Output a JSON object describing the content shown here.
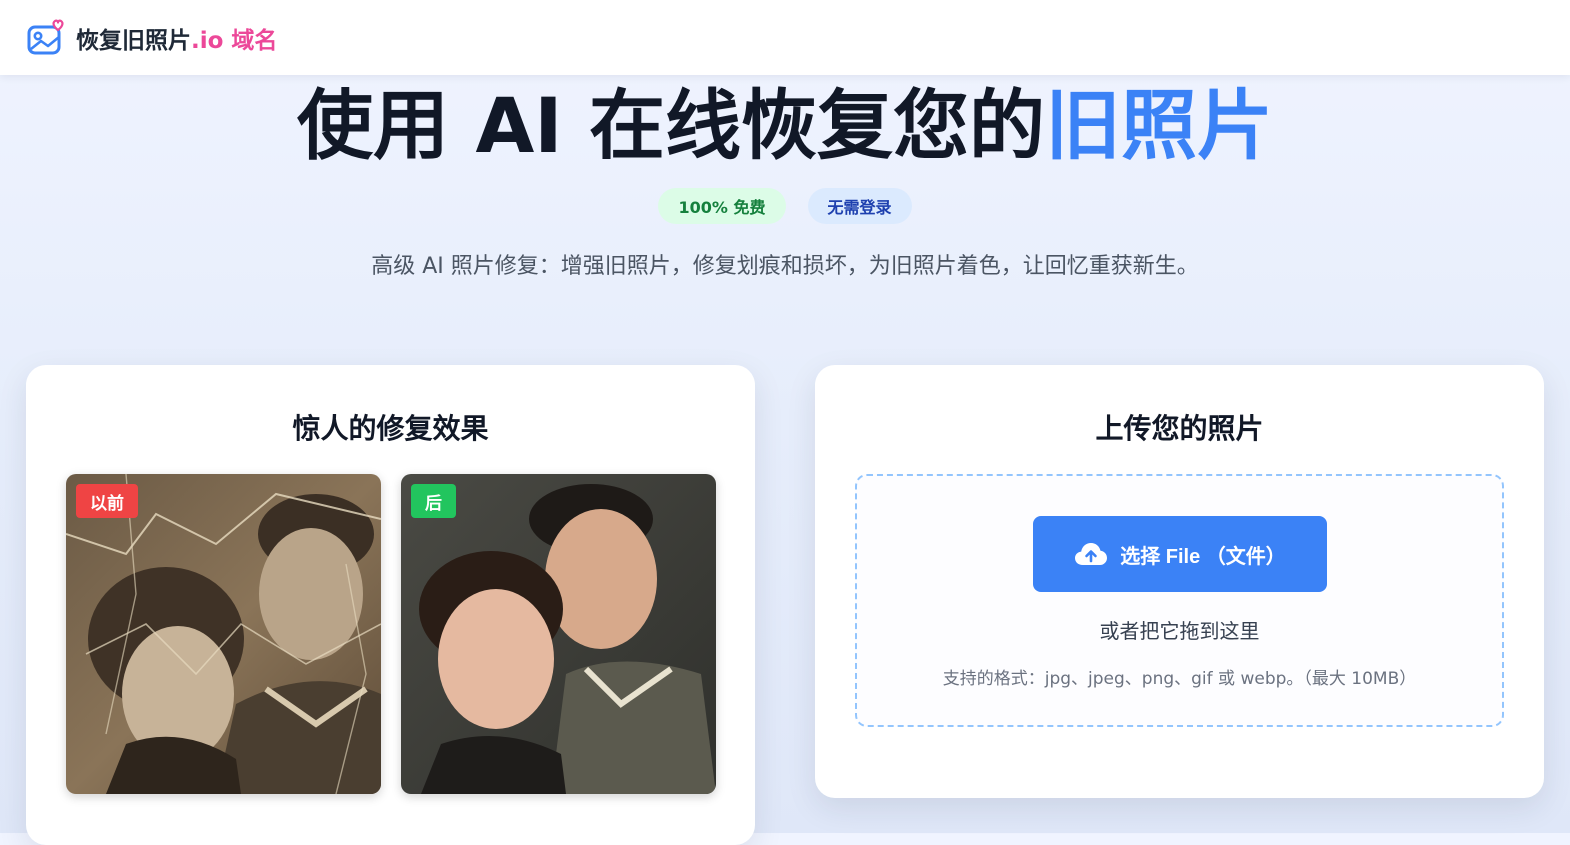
{
  "navbar": {
    "brand_main": "恢复旧照片",
    "brand_accent": ".io 域名",
    "logo_icon": "photo-heart-icon"
  },
  "hero": {
    "title_main": "使用 AI 在线恢复您的",
    "title_highlight": "旧照片",
    "badges": [
      "100% 免费",
      "无需登录"
    ],
    "subtitle": "高级 AI 照片修复：增强旧照片，修复划痕和损坏，为旧照片着色，让回忆重获新生。"
  },
  "results_card": {
    "title": "惊人的修复效果",
    "before_label": "以前",
    "after_label": "后"
  },
  "upload_card": {
    "title": "上传您的照片",
    "button_label": "选择 File （文件）",
    "button_icon": "cloud-upload-icon",
    "drop_text": "或者把它拖到这里",
    "format_text": "支持的格式：jpg、jpeg、png、gif 或 webp。（最大 10MB）"
  },
  "colors": {
    "accent_blue": "#3b82f6",
    "brand_pink": "#ec4899",
    "before_tag": "#ef4444",
    "after_tag": "#22c55e"
  }
}
